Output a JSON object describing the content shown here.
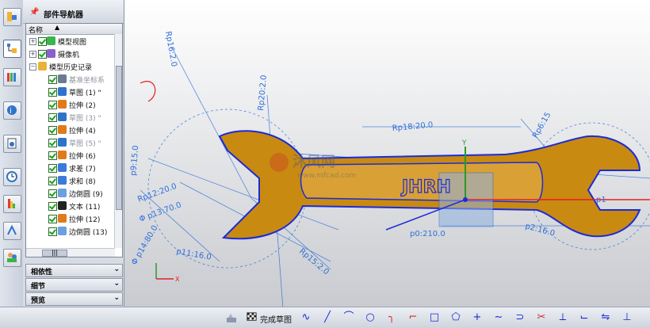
{
  "navigator": {
    "title": "部件导航器",
    "column_name": "名称",
    "tree": [
      {
        "label": "模型视图",
        "expander": "+",
        "icon": "model-views-icon"
      },
      {
        "label": "摄像机",
        "expander": "+",
        "icon": "camera-icon"
      },
      {
        "label": "模型历史记录",
        "expander": "−",
        "icon": "folder-icon"
      },
      {
        "label": "基准坐标系",
        "icon": "datum-csys-icon",
        "dim": true
      },
      {
        "label": "草图 (1) \"",
        "icon": "sketch-icon"
      },
      {
        "label": "拉伸 (2)",
        "icon": "extrude-icon"
      },
      {
        "label": "草图 (3) \"",
        "icon": "sketch-icon",
        "dim": true
      },
      {
        "label": "拉伸 (4)",
        "icon": "extrude-icon"
      },
      {
        "label": "草图 (5) \"",
        "icon": "sketch-icon",
        "dim": true
      },
      {
        "label": "拉伸 (6)",
        "icon": "extrude-icon"
      },
      {
        "label": "求差 (7)",
        "icon": "subtract-icon"
      },
      {
        "label": "求和 (8)",
        "icon": "unite-icon"
      },
      {
        "label": "边倒圆 (9)",
        "icon": "edge-blend-icon"
      },
      {
        "label": "文本 (11)",
        "icon": "text-icon"
      },
      {
        "label": "拉伸 (12)",
        "icon": "extrude-icon"
      },
      {
        "label": "边倒圆 (13)",
        "icon": "edge-blend-icon"
      }
    ],
    "panels": [
      "相依性",
      "细节",
      "预览"
    ]
  },
  "viewport": {
    "dimensions": [
      "Rp16:2.0",
      "Rp20:2.0",
      "Rp18:20.0",
      "Rp6:15",
      "p9:15.0",
      "Rp12:20.0",
      "Φ p13:70.0",
      "Φ p14:80.0",
      "p11:16.0",
      "Rp15:2.0",
      "p0:210.0",
      "p2:16.0",
      "p1"
    ],
    "engraved_text": "JHRH",
    "watermark": "沐风网",
    "watermark_url": "www.mfcad.com",
    "axis_labels": {
      "y": "Y",
      "x": "X"
    },
    "colors": {
      "body": "#c98a12",
      "edges": "#1b2bd6",
      "dim_lines": "#2e6fd9",
      "selection": "#e62020"
    }
  },
  "bottombar": {
    "finish_sketch": "完成草图",
    "tools": [
      "profile-icon",
      "line-icon",
      "arc-icon",
      "circle-icon",
      "fillet-icon",
      "chamfer-icon",
      "rectangle-icon",
      "polygon-icon",
      "point-icon",
      "studio-spline-icon",
      "offset-curve-icon",
      "trim-icon",
      "extend-icon",
      "corner-icon",
      "mirror-icon",
      "constraints-icon"
    ]
  }
}
